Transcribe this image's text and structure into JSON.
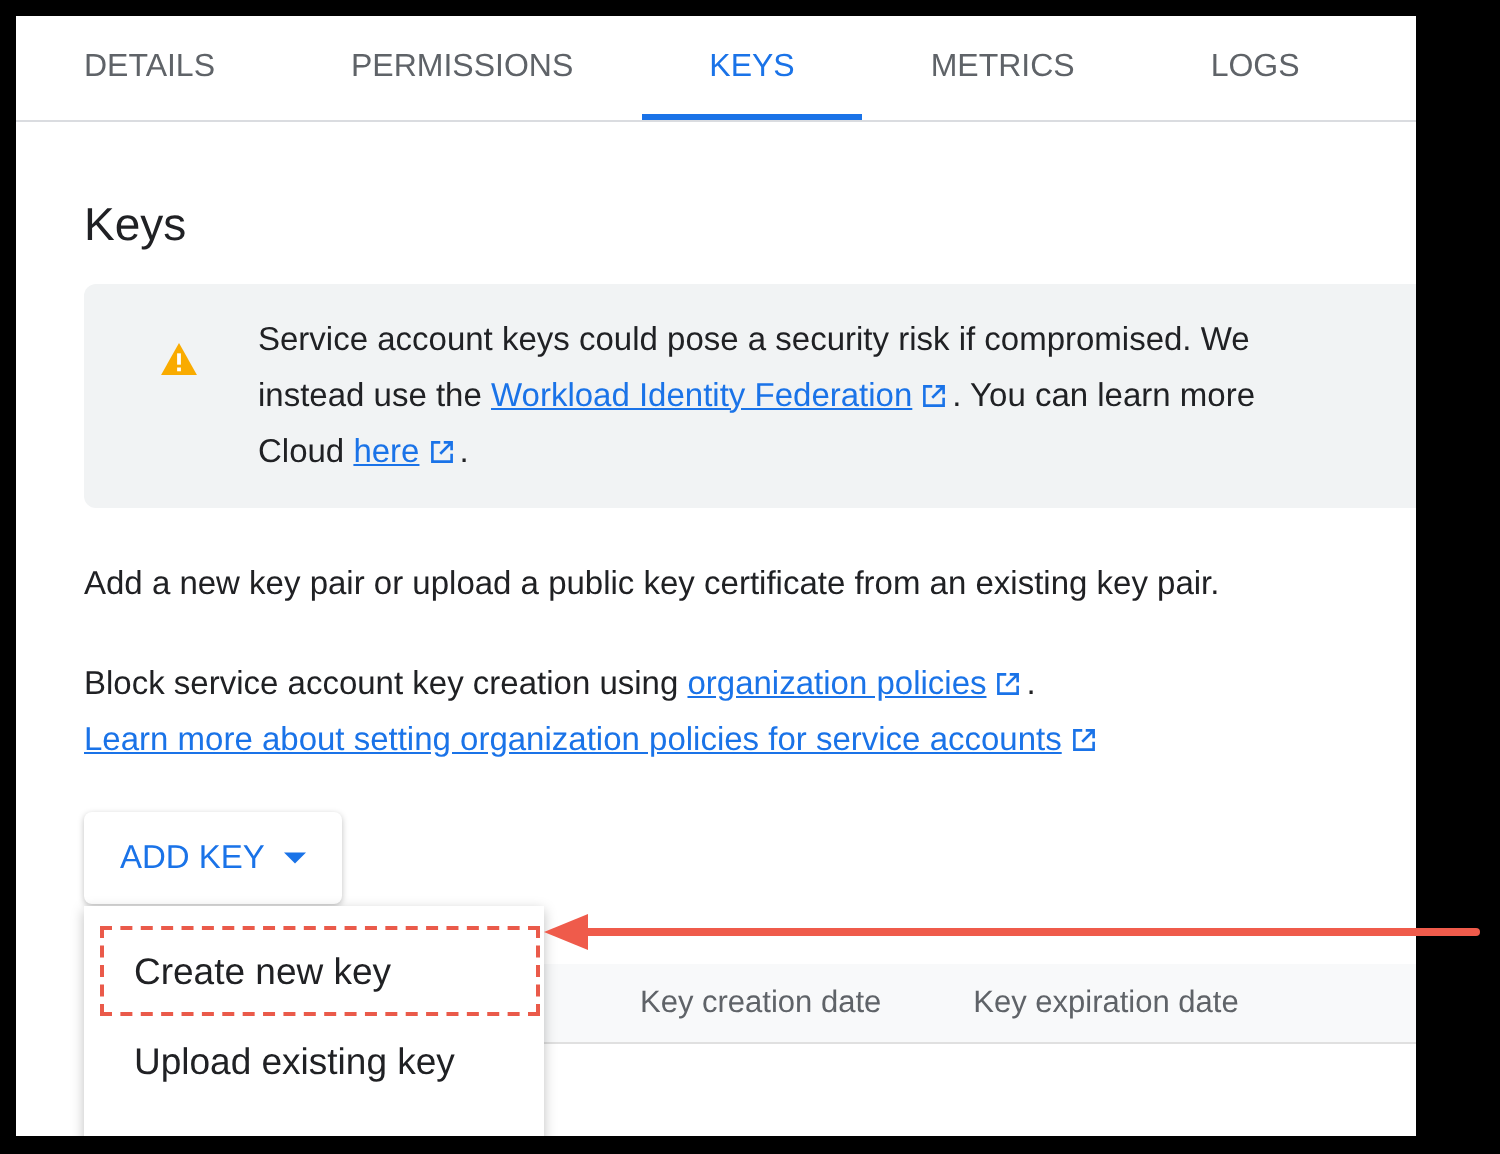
{
  "tabs": [
    {
      "label": "DETAILS",
      "selected": false
    },
    {
      "label": "PERMISSIONS",
      "selected": false
    },
    {
      "label": "KEYS",
      "selected": true
    },
    {
      "label": "METRICS",
      "selected": false
    },
    {
      "label": "LOGS",
      "selected": false
    }
  ],
  "heading": "Keys",
  "warning": {
    "lines": [
      [
        {
          "kind": "text",
          "text": "Service account keys could pose a security risk if compromised. We"
        }
      ],
      [
        {
          "kind": "text",
          "text": "instead use the "
        },
        {
          "kind": "link",
          "text": "Workload Identity Federation"
        },
        {
          "kind": "text",
          "text": ". You can learn more"
        }
      ],
      [
        {
          "kind": "text",
          "text": "Cloud "
        },
        {
          "kind": "link",
          "text": "here"
        },
        {
          "kind": "text",
          "text": "."
        }
      ]
    ]
  },
  "intro": [
    {
      "kind": "text",
      "text": "Add a new key pair or upload a public key certificate from an existing key pair."
    }
  ],
  "policy_lines": [
    [
      {
        "kind": "text",
        "text": "Block service account key creation using "
      },
      {
        "kind": "link",
        "text": "organization policies"
      },
      {
        "kind": "text",
        "text": "."
      }
    ],
    [
      {
        "kind": "link",
        "text": "Learn more about setting organization policies for service accounts"
      }
    ]
  ],
  "add_key_button": {
    "label": "ADD KEY"
  },
  "menu": {
    "items": [
      {
        "label": "Create new key",
        "highlighted": true
      },
      {
        "label": "Upload existing key",
        "highlighted": false
      }
    ]
  },
  "table": {
    "columns": [
      "Key creation date",
      "Key expiration date"
    ]
  }
}
